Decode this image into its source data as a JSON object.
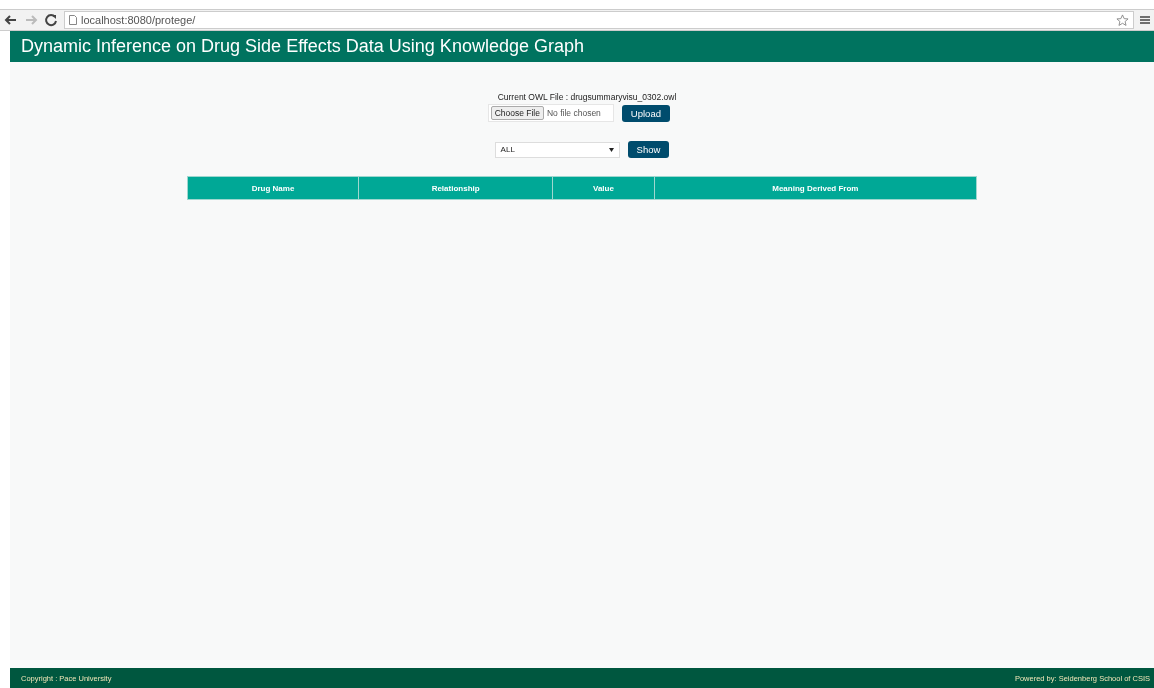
{
  "browser": {
    "url": "localhost:8080/protege/"
  },
  "header": {
    "title": "Dynamic Inference on Drug Side Effects Data Using Knowledge Graph"
  },
  "upload": {
    "current_file_label": "Current OWL File : drugsummaryvisu_0302.owl",
    "choose_button": "Choose File",
    "file_status": "No file chosen",
    "upload_button": "Upload"
  },
  "filter": {
    "value": "ALL",
    "show_button": "Show"
  },
  "table": {
    "columns": [
      "Drug Name",
      "Relationship",
      "Value",
      "Meaning Derived From"
    ]
  },
  "footer": {
    "left": "Copyright : Pace University",
    "right": "Powered by: Seidenberg School of CSIS"
  }
}
